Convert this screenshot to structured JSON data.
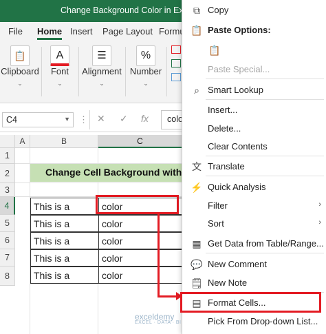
{
  "window": {
    "title": "Change Background Color in Excel"
  },
  "ribbon_tabs": [
    "File",
    "Home",
    "Insert",
    "Page Layout",
    "Formu"
  ],
  "ribbon_groups": [
    {
      "label": "Clipboard",
      "icon": "clipboard-icon",
      "glyph": "📋"
    },
    {
      "label": "Font",
      "icon": "font-color-icon",
      "glyph": "A"
    },
    {
      "label": "Alignment",
      "icon": "alignment-icon",
      "glyph": "☰"
    },
    {
      "label": "Number",
      "icon": "percent-icon",
      "glyph": "%"
    }
  ],
  "formula_bar": {
    "name_box": "C4",
    "cancel": "✕",
    "enter": "✓",
    "fx": "fx",
    "content": "colo"
  },
  "columns": [
    "A",
    "B",
    "C"
  ],
  "rows": [
    "1",
    "2",
    "3",
    "4",
    "5",
    "6",
    "7",
    "8"
  ],
  "selected_cell": {
    "column": "C",
    "row": "4"
  },
  "banner_text": "Change Cell Background with",
  "table": [
    [
      "This is a",
      "color"
    ],
    [
      "This is a",
      "color"
    ],
    [
      "This is a",
      "color"
    ],
    [
      "This is a",
      "color"
    ],
    [
      "This is a",
      "color"
    ]
  ],
  "context_menu": {
    "items": [
      {
        "label": "Copy",
        "icon": "copy-icon",
        "glyph": "⧉",
        "disabled": false
      },
      {
        "label": "Paste Options:",
        "icon": "paste-icon",
        "glyph": "📋",
        "bold": true
      },
      {
        "label": "",
        "icon": "paste-clipboard-icon",
        "glyph": "📋",
        "disabled": true
      },
      {
        "label": "Paste Special...",
        "disabled": true
      },
      {
        "label": "Smart Lookup",
        "icon": "search-icon",
        "glyph": "⌕"
      },
      {
        "label": "Insert..."
      },
      {
        "label": "Delete..."
      },
      {
        "label": "Clear Contents"
      },
      {
        "label": "Translate",
        "icon": "translate-icon",
        "glyph": "文"
      },
      {
        "label": "Quick Analysis",
        "icon": "quick-analysis-icon",
        "glyph": "⚡"
      },
      {
        "label": "Filter",
        "submenu": true
      },
      {
        "label": "Sort",
        "submenu": true
      },
      {
        "label": "Get Data from Table/Range...",
        "icon": "table-icon",
        "glyph": "▦"
      },
      {
        "label": "New Comment",
        "icon": "comment-icon",
        "glyph": "💬"
      },
      {
        "label": "New Note",
        "icon": "note-icon",
        "glyph": "🗒"
      },
      {
        "label": "Format Cells...",
        "icon": "format-cells-icon",
        "glyph": "▤"
      },
      {
        "label": "Pick From Drop-down List..."
      }
    ]
  },
  "watermark": {
    "name": "exceldemy",
    "tagline": "EXCEL · DATA · BI"
  },
  "colors": {
    "excel_green": "#217346",
    "highlight_red": "#e31b23",
    "banner_green": "#c6e0b4"
  }
}
